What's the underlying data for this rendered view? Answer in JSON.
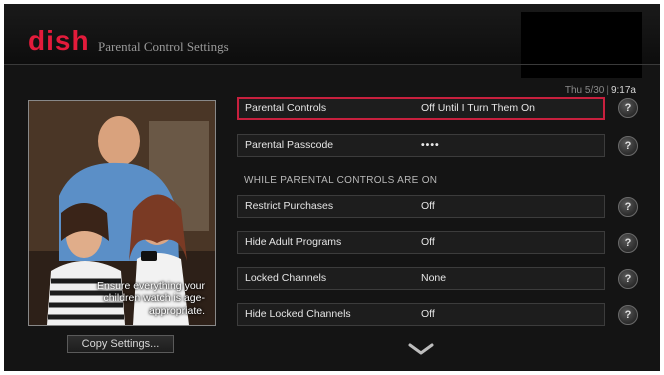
{
  "brand": {
    "logo_text": "dish",
    "accent_color": "#e31b3b"
  },
  "header": {
    "title": "Parental Control Settings"
  },
  "status": {
    "date": "Thu 5/30",
    "time": "9:17a"
  },
  "promo": {
    "caption": "Ensure everything your children watch is age-appropriate."
  },
  "actions": {
    "copy_settings": "Copy Settings..."
  },
  "settings": {
    "section_heading": "WHILE PARENTAL CONTROLS ARE ON",
    "rows": [
      {
        "label": "Parental Controls",
        "value": "Off Until I Turn Them On",
        "selected": true
      },
      {
        "label": "Parental Passcode",
        "value": "••••"
      },
      {
        "label": "Restrict Purchases",
        "value": "Off"
      },
      {
        "label": "Hide Adult Programs",
        "value": "Off"
      },
      {
        "label": "Locked Channels",
        "value": "None"
      },
      {
        "label": "Hide Locked Channels",
        "value": "Off"
      }
    ],
    "help_glyph": "?"
  },
  "icons": {
    "help": "question-mark-icon",
    "more": "chevron-down-icon"
  }
}
